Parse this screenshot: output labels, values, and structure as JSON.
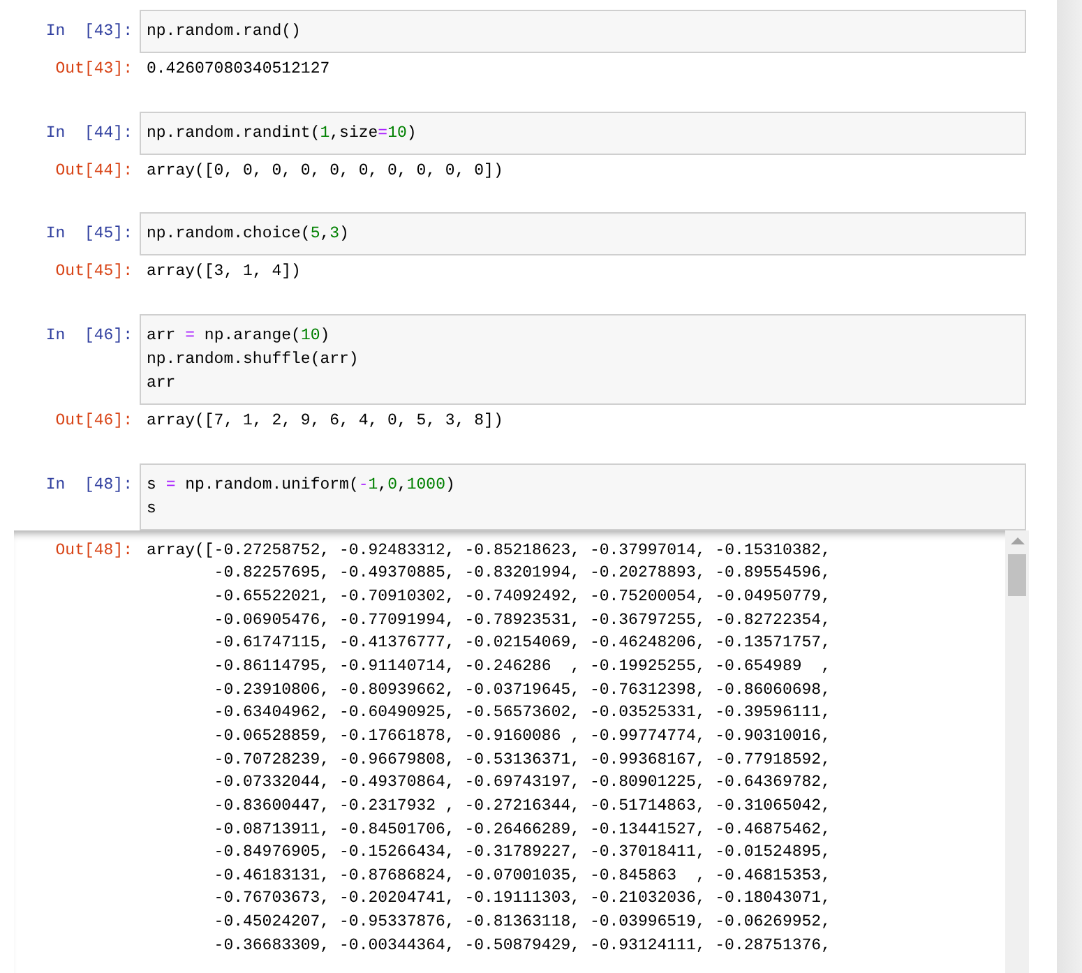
{
  "cells": [
    {
      "in_prompt": "In  [43]:",
      "code": [
        [
          {
            "kind": "plain",
            "text": "np.random.rand()"
          }
        ]
      ],
      "out_prompt": "Out[43]:",
      "output": [
        "0.42607080340512127"
      ],
      "scrolled": false
    },
    {
      "in_prompt": "In  [44]:",
      "code": [
        [
          {
            "kind": "plain",
            "text": "np.random.randint("
          },
          {
            "kind": "number",
            "text": "1"
          },
          {
            "kind": "plain",
            "text": ",size"
          },
          {
            "kind": "operator",
            "text": "="
          },
          {
            "kind": "number",
            "text": "10"
          },
          {
            "kind": "plain",
            "text": ")"
          }
        ]
      ],
      "out_prompt": "Out[44]:",
      "output": [
        "array([0, 0, 0, 0, 0, 0, 0, 0, 0, 0])"
      ],
      "scrolled": false
    },
    {
      "in_prompt": "In  [45]:",
      "code": [
        [
          {
            "kind": "plain",
            "text": "np.random.choice("
          },
          {
            "kind": "number",
            "text": "5"
          },
          {
            "kind": "plain",
            "text": ","
          },
          {
            "kind": "number",
            "text": "3"
          },
          {
            "kind": "plain",
            "text": ")"
          }
        ]
      ],
      "out_prompt": "Out[45]:",
      "output": [
        "array([3, 1, 4])"
      ],
      "scrolled": false
    },
    {
      "in_prompt": "In  [46]:",
      "code": [
        [
          {
            "kind": "plain",
            "text": "arr "
          },
          {
            "kind": "operator",
            "text": "="
          },
          {
            "kind": "plain",
            "text": " np.arange("
          },
          {
            "kind": "number",
            "text": "10"
          },
          {
            "kind": "plain",
            "text": ")"
          }
        ],
        [
          {
            "kind": "plain",
            "text": "np.random.shuffle(arr)"
          }
        ],
        [
          {
            "kind": "plain",
            "text": "arr"
          }
        ]
      ],
      "out_prompt": "Out[46]:",
      "output": [
        "array([7, 1, 2, 9, 6, 4, 0, 5, 3, 8])"
      ],
      "scrolled": false
    },
    {
      "in_prompt": "In  [48]:",
      "code": [
        [
          {
            "kind": "plain",
            "text": "s "
          },
          {
            "kind": "operator",
            "text": "="
          },
          {
            "kind": "plain",
            "text": " np.random.uniform("
          },
          {
            "kind": "operator",
            "text": "-"
          },
          {
            "kind": "number",
            "text": "1"
          },
          {
            "kind": "plain",
            "text": ","
          },
          {
            "kind": "number",
            "text": "0"
          },
          {
            "kind": "plain",
            "text": ","
          },
          {
            "kind": "number",
            "text": "1000"
          },
          {
            "kind": "plain",
            "text": ")"
          }
        ],
        [
          {
            "kind": "plain",
            "text": "s"
          }
        ]
      ],
      "out_prompt": "Out[48]:",
      "output": [
        "array([-0.27258752, -0.92483312, -0.85218623, -0.37997014, -0.15310382,",
        "-0.82257695, -0.49370885, -0.83201994, -0.20278893, -0.89554596,",
        "-0.65522021, -0.70910302, -0.74092492, -0.75200054, -0.04950779,",
        "-0.06905476, -0.77091994, -0.78923531, -0.36797255, -0.82722354,",
        "-0.61747115, -0.41376777, -0.02154069, -0.46248206, -0.13571757,",
        "-0.86114795, -0.91140714, -0.246286  , -0.19925255, -0.654989  ,",
        "-0.23910806, -0.80939662, -0.03719645, -0.76312398, -0.86060698,",
        "-0.63404962, -0.60490925, -0.56573602, -0.03525331, -0.39596111,",
        "-0.06528859, -0.17661878, -0.9160086 , -0.99774774, -0.90310016,",
        "-0.70728239, -0.96679808, -0.53136371, -0.99368167, -0.77918592,",
        "-0.07332044, -0.49370864, -0.69743197, -0.80901225, -0.64369782,",
        "-0.83600447, -0.2317932 , -0.27216344, -0.51714863, -0.31065042,",
        "-0.08713911, -0.84501706, -0.26466289, -0.13441527, -0.46875462,",
        "-0.84976905, -0.15266434, -0.31789227, -0.37018411, -0.01524895,",
        "-0.46183131, -0.87686824, -0.07001035, -0.845863  , -0.46815353,",
        "-0.76703673, -0.20204741, -0.19111303, -0.21032036, -0.18043071,",
        "-0.45024207, -0.95337876, -0.81363118, -0.03996519, -0.06269952,",
        "-0.36683309, -0.00344364, -0.50879429, -0.93124111, -0.28751376,"
      ],
      "scrolled": true
    }
  ]
}
